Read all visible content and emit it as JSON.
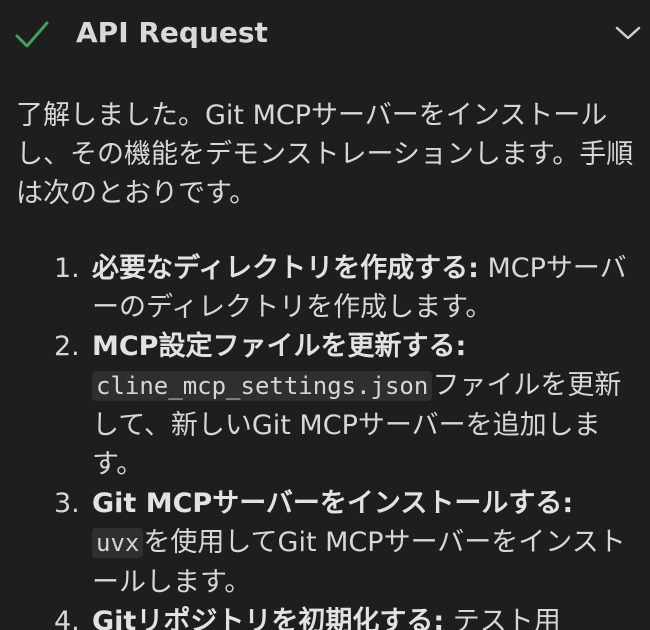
{
  "header": {
    "title": "API Request",
    "check_icon": "check-icon",
    "chevron_icon": "chevron-down-icon",
    "check_color": "#3fa35b"
  },
  "intro": "了解しました。Git MCPサーバーをインストールし、その機能をデモンストレーションします。手順は次のとおりです。",
  "steps": [
    {
      "number": "1.",
      "title": "必要なディレクトリを作成する:",
      "text": " MCPサーバーのディレクトリを作成します。"
    },
    {
      "number": "2.",
      "title": "MCP設定ファイルを更新する:",
      "code": "cline_mcp_settings.json",
      "text": "ファイルを更新して、新しいGit MCPサーバーを追加します。"
    },
    {
      "number": "3.",
      "title": "Git MCPサーバーをインストールする:",
      "code": "uvx",
      "text": "を使用してGit MCPサーバーをインストールします。"
    },
    {
      "number": "4.",
      "title": "Gitリポジトリを初期化する:",
      "text": " テスト用"
    }
  ]
}
